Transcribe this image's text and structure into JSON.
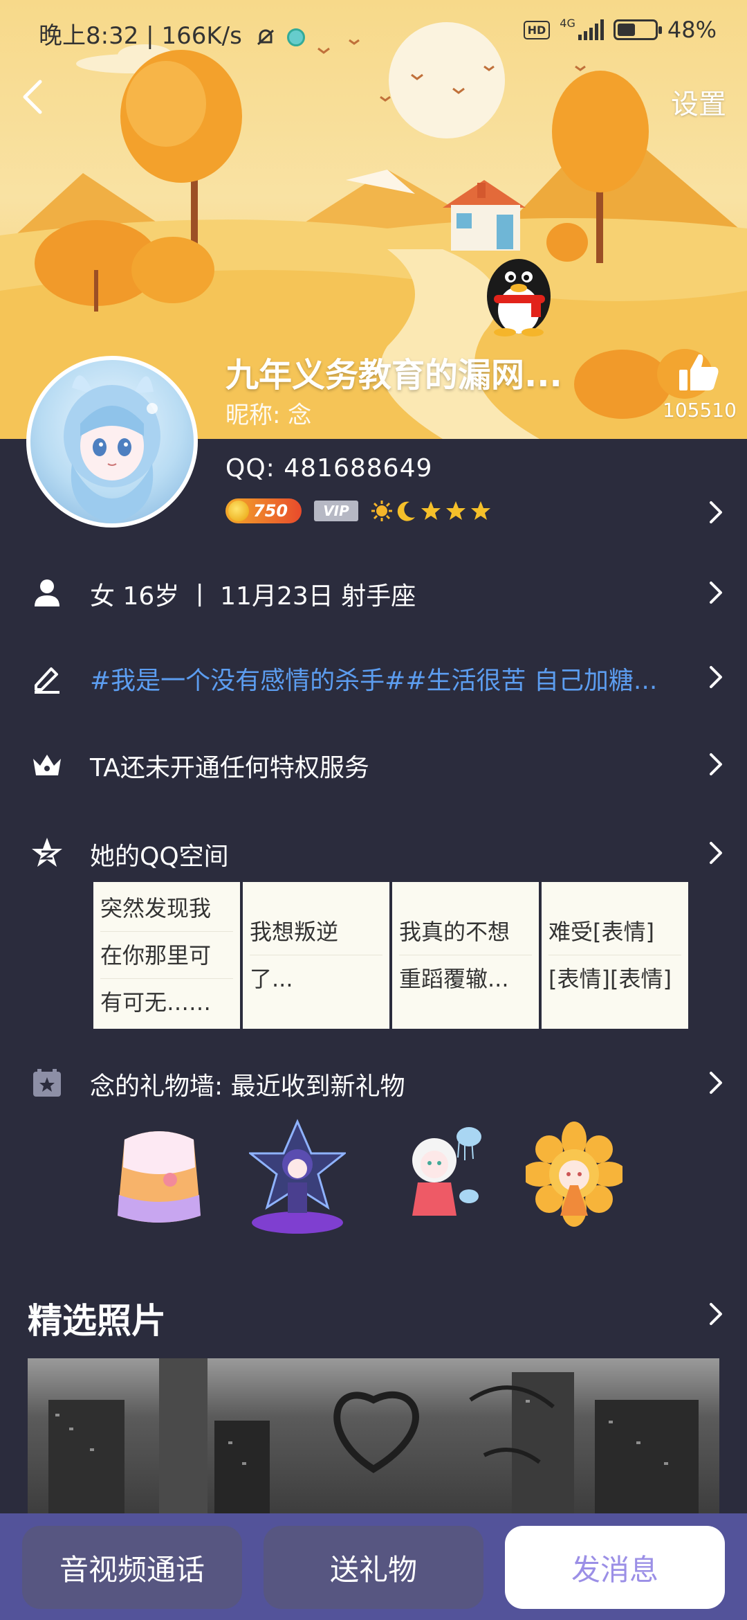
{
  "status_bar": {
    "time": "晚上8:32",
    "speed": "166K/s",
    "hd": "HD",
    "network": "4G",
    "battery": "48%",
    "battery_level": 0.48
  },
  "header": {
    "settings_label": "设置",
    "title": "九年义务教育的漏网...",
    "nickname_line": "昵称: 念",
    "like_count": "105510"
  },
  "profile": {
    "qq_line": "QQ: 481688649",
    "level_value": "750",
    "vip_label": "VIP"
  },
  "rows": {
    "basic_info": "女  16岁 丨 11月23日  射手座",
    "signature": "#我是一个没有感情的杀手##生活很苦 自己加糖...",
    "privilege": "TA还未开通任何特权服务",
    "qzone": "她的QQ空间",
    "gifts": "念的礼物墙: 最近收到新礼物"
  },
  "qzone_posts": [
    {
      "lines": [
        "突然发现我",
        "在你那里可",
        "有可无……"
      ]
    },
    {
      "lines": [
        "我想叛逆",
        "了..."
      ]
    },
    {
      "lines": [
        "我真的不想",
        "重蹈覆辙..."
      ]
    },
    {
      "lines": [
        "难受[表情]",
        "[表情][表情]"
      ]
    }
  ],
  "gift_items": [
    "jelly-cake-gift",
    "starry-girl-gift",
    "jellyfish-girl-gift",
    "flower-girl-gift"
  ],
  "photos": {
    "heading": "精选照片"
  },
  "bottom_bar": {
    "call_label": "音视频通话",
    "gift_label": "送礼物",
    "message_label": "发消息"
  },
  "colors": {
    "background": "#2b2c3d",
    "link": "#5c9df0",
    "bottom_bar": "#53539a",
    "message_text": "#9b8fe6"
  }
}
